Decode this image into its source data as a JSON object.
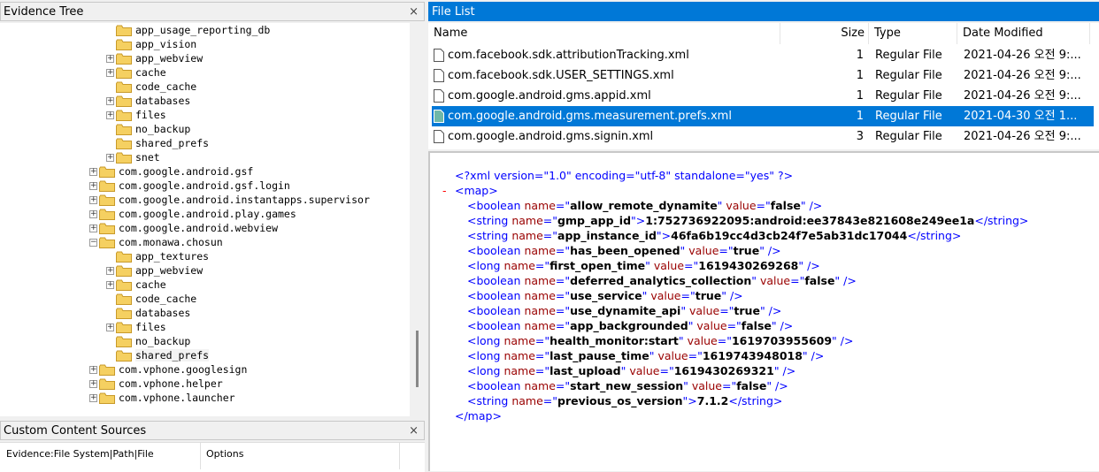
{
  "evidence_tree": {
    "title": "Evidence Tree",
    "close": "×",
    "nodes": [
      {
        "label": "app_usage_reporting_db",
        "expander": "",
        "indent": 2
      },
      {
        "label": "app_vision",
        "expander": "",
        "indent": 2
      },
      {
        "label": "app_webview",
        "expander": "+",
        "indent": 2
      },
      {
        "label": "cache",
        "expander": "+",
        "indent": 2
      },
      {
        "label": "code_cache",
        "expander": "",
        "indent": 2
      },
      {
        "label": "databases",
        "expander": "+",
        "indent": 2
      },
      {
        "label": "files",
        "expander": "+",
        "indent": 2
      },
      {
        "label": "no_backup",
        "expander": "",
        "indent": 2
      },
      {
        "label": "shared_prefs",
        "expander": "",
        "indent": 2
      },
      {
        "label": "snet",
        "expander": "+",
        "indent": 2
      },
      {
        "label": "com.google.android.gsf",
        "expander": "+",
        "indent": 1
      },
      {
        "label": "com.google.android.gsf.login",
        "expander": "+",
        "indent": 1
      },
      {
        "label": "com.google.android.instantapps.supervisor",
        "expander": "+",
        "indent": 1
      },
      {
        "label": "com.google.android.play.games",
        "expander": "+",
        "indent": 1
      },
      {
        "label": "com.google.android.webview",
        "expander": "+",
        "indent": 1
      },
      {
        "label": "com.monawa.chosun",
        "expander": "−",
        "indent": 1
      },
      {
        "label": "app_textures",
        "expander": "",
        "indent": 2
      },
      {
        "label": "app_webview",
        "expander": "+",
        "indent": 2
      },
      {
        "label": "cache",
        "expander": "+",
        "indent": 2
      },
      {
        "label": "code_cache",
        "expander": "",
        "indent": 2
      },
      {
        "label": "databases",
        "expander": "",
        "indent": 2
      },
      {
        "label": "files",
        "expander": "+",
        "indent": 2
      },
      {
        "label": "no_backup",
        "expander": "",
        "indent": 2
      },
      {
        "label": "shared_prefs",
        "expander": "",
        "indent": 2,
        "selected": true
      },
      {
        "label": "com.vphone.googlesign",
        "expander": "+",
        "indent": 1
      },
      {
        "label": "com.vphone.helper",
        "expander": "+",
        "indent": 1
      },
      {
        "label": "com.vphone.launcher",
        "expander": "+",
        "indent": 1
      }
    ]
  },
  "custom_content": {
    "title": "Custom Content Sources",
    "close": "×",
    "col1": "Evidence:File System|Path|File",
    "col2": "Options"
  },
  "file_list": {
    "title": "File List",
    "headers": {
      "name": "Name",
      "size": "Size",
      "type": "Type",
      "date": "Date Modified"
    },
    "rows": [
      {
        "name": "com.facebook.sdk.attributionTracking.xml",
        "size": "1",
        "type": "Regular File",
        "date": "2021-04-26 오전 9:..."
      },
      {
        "name": "com.facebook.sdk.USER_SETTINGS.xml",
        "size": "1",
        "type": "Regular File",
        "date": "2021-04-26 오전 9:..."
      },
      {
        "name": "com.google.android.gms.appid.xml",
        "size": "1",
        "type": "Regular File",
        "date": "2021-04-26 오전 9:..."
      },
      {
        "name": "com.google.android.gms.measurement.prefs.xml",
        "size": "1",
        "type": "Regular File",
        "date": "2021-04-30 오전 1...",
        "selected": true
      },
      {
        "name": "com.google.android.gms.signin.xml",
        "size": "3",
        "type": "Regular File",
        "date": "2021-04-26 오전 9:..."
      }
    ]
  },
  "xml_view": {
    "decl": "<?xml version=\"1.0\" encoding=\"utf-8\" standalone=\"yes\" ?>",
    "collapse": "-",
    "open_map": "<map>",
    "close_map": "</map>",
    "entries": [
      {
        "tag": "boolean",
        "name": "allow_remote_dynamite",
        "value": "false",
        "form": "attr"
      },
      {
        "tag": "string",
        "name": "gmp_app_id",
        "value": "1:752736922095:android:ee37843e821608e249ee1a",
        "form": "text"
      },
      {
        "tag": "string",
        "name": "app_instance_id",
        "value": "46fa6b19cc4d3cb24f7e5ab31dc17044",
        "form": "text"
      },
      {
        "tag": "boolean",
        "name": "has_been_opened",
        "value": "true",
        "form": "attr"
      },
      {
        "tag": "long",
        "name": "first_open_time",
        "value": "1619430269268",
        "form": "attr"
      },
      {
        "tag": "boolean",
        "name": "deferred_analytics_collection",
        "value": "false",
        "form": "attr"
      },
      {
        "tag": "boolean",
        "name": "use_service",
        "value": "true",
        "form": "attr"
      },
      {
        "tag": "boolean",
        "name": "use_dynamite_api",
        "value": "true",
        "form": "attr"
      },
      {
        "tag": "boolean",
        "name": "app_backgrounded",
        "value": "false",
        "form": "attr"
      },
      {
        "tag": "long",
        "name": "health_monitor:start",
        "value": "1619703955609",
        "form": "attr"
      },
      {
        "tag": "long",
        "name": "last_pause_time",
        "value": "1619743948018",
        "form": "attr"
      },
      {
        "tag": "long",
        "name": "last_upload",
        "value": "1619430269321",
        "form": "attr"
      },
      {
        "tag": "boolean",
        "name": "start_new_session",
        "value": "false",
        "form": "attr"
      },
      {
        "tag": "string",
        "name": "previous_os_version",
        "value": "7.1.2",
        "form": "text"
      }
    ]
  },
  "colors": {
    "accent": "#0078d7",
    "xml_tag": "#0000ff",
    "xml_attr": "#990000",
    "folder": "#f5d061"
  }
}
